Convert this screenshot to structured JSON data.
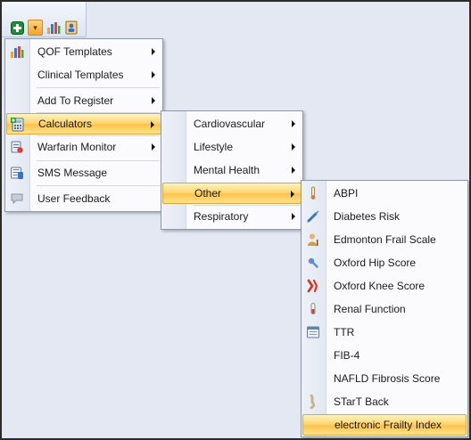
{
  "toolbar": {
    "icons": [
      "add-icon",
      "dropdown-chevron-icon",
      "chart-icon",
      "contacts-icon"
    ],
    "accent": "#f5a22a"
  },
  "main_menu": {
    "items": [
      {
        "label": "QOF Templates",
        "icon": "chart-icon",
        "submenu": true
      },
      {
        "label": "Clinical Templates",
        "icon": "none",
        "submenu": true
      },
      {
        "label": "Add To Register",
        "icon": "none",
        "submenu": true
      },
      {
        "label": "Calculators",
        "icon": "calculator-icon",
        "submenu": true,
        "highlighted": true
      },
      {
        "label": "Warfarin Monitor",
        "icon": "warfarin-icon",
        "submenu": true
      },
      {
        "label": "SMS Message",
        "icon": "sms-icon",
        "submenu": false
      },
      {
        "label": "User Feedback",
        "icon": "feedback-icon",
        "submenu": false
      }
    ]
  },
  "calculators_menu": {
    "items": [
      {
        "label": "Cardiovascular",
        "submenu": true
      },
      {
        "label": "Lifestyle",
        "submenu": true
      },
      {
        "label": "Mental Health",
        "submenu": true
      },
      {
        "label": "Other",
        "submenu": true,
        "highlighted": true
      },
      {
        "label": "Respiratory",
        "submenu": true
      }
    ]
  },
  "other_menu": {
    "items": [
      {
        "label": "ABPI",
        "icon": "thermometer-icon"
      },
      {
        "label": "Diabetes Risk",
        "icon": "syringe-icon"
      },
      {
        "label": "Edmonton Frail Scale",
        "icon": "person-icon"
      },
      {
        "label": "Oxford Hip Score",
        "icon": "hip-icon"
      },
      {
        "label": "Oxford Knee Score",
        "icon": "knee-icon"
      },
      {
        "label": "Renal Function",
        "icon": "test-tube-icon"
      },
      {
        "label": "TTR",
        "icon": "calendar-icon"
      },
      {
        "label": "FIB-4",
        "icon": "none"
      },
      {
        "label": "NAFLD Fibrosis Score",
        "icon": "none"
      },
      {
        "label": "STarT Back",
        "icon": "back-icon"
      },
      {
        "label": "electronic Frailty Index",
        "icon": "none",
        "highlighted": true
      }
    ]
  }
}
